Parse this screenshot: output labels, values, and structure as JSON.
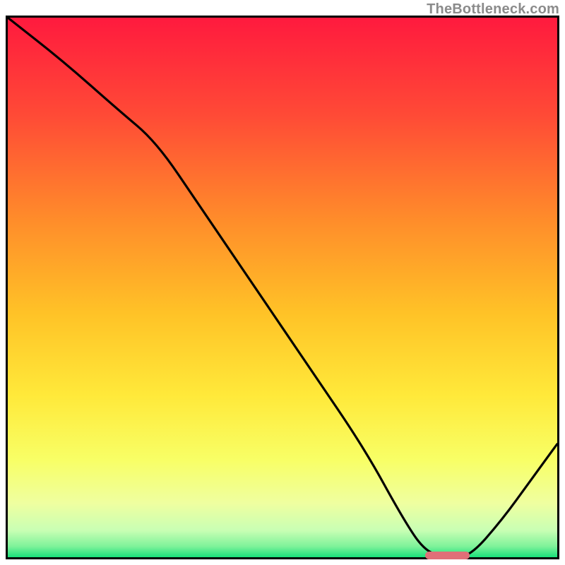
{
  "watermark": "TheBottleneck.com",
  "colors": {
    "border": "#000000",
    "curve": "#000000",
    "marker": "#e06f78",
    "gradient_top": "#ff1a3e",
    "gradient_upper": "#ff6a2f",
    "gradient_mid": "#ffd028",
    "gradient_lower": "#f6ff62",
    "gradient_bottom_plateau": "#d9ffb0",
    "gradient_bottom": "#18e07a"
  },
  "chart_data": {
    "type": "line",
    "title": "",
    "xlabel": "",
    "ylabel": "",
    "xlim": [
      0,
      100
    ],
    "ylim": [
      0,
      100
    ],
    "x": [
      0,
      10,
      20,
      27,
      35,
      45,
      55,
      65,
      72,
      76,
      80,
      84,
      90,
      95,
      100
    ],
    "values": [
      100,
      92,
      83,
      77,
      65,
      50,
      35,
      20,
      7,
      1,
      0,
      0,
      7,
      14,
      21
    ],
    "note": "Values are relative (0 = bottom/green, 100 = top/red). Curve descends from top-left, steepens after ~x=27, bottoms out near x≈78–84, then rises toward bottom-right.",
    "marker": {
      "x_start": 76,
      "x_end": 84,
      "y": 0
    },
    "gradient_stops": [
      {
        "pct": 0,
        "color": "#ff1a3e"
      },
      {
        "pct": 18,
        "color": "#ff4a36"
      },
      {
        "pct": 38,
        "color": "#ff8e2a"
      },
      {
        "pct": 55,
        "color": "#ffc327"
      },
      {
        "pct": 70,
        "color": "#ffe93a"
      },
      {
        "pct": 82,
        "color": "#f8ff66"
      },
      {
        "pct": 90,
        "color": "#efffa0"
      },
      {
        "pct": 95,
        "color": "#c9ffb4"
      },
      {
        "pct": 98,
        "color": "#7ef29a"
      },
      {
        "pct": 100,
        "color": "#18e07a"
      }
    ]
  }
}
